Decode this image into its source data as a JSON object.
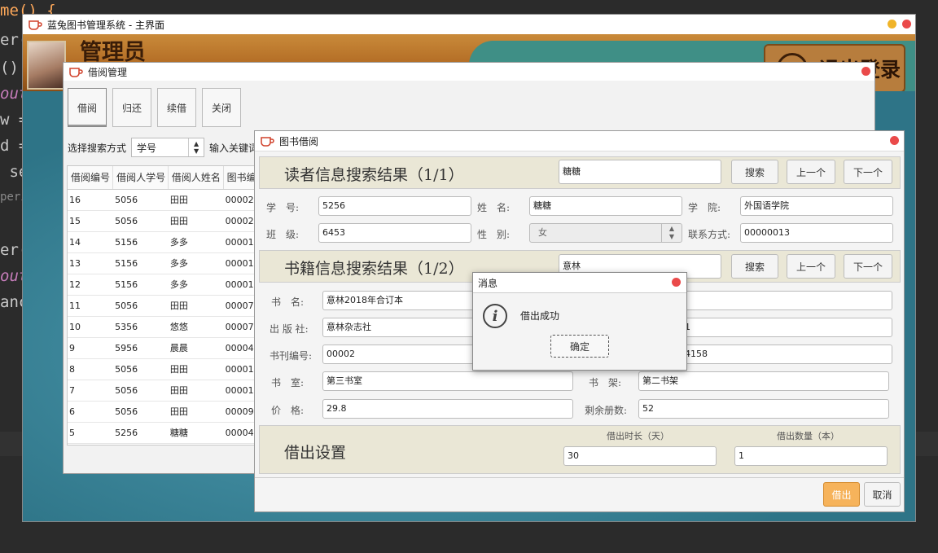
{
  "ide": {
    "lines": [
      "me() {",
      "er(",
      "()",
      "out",
      "w =",
      "d =",
      " se",
      "peri",
      "er(",
      "out",
      "anc"
    ]
  },
  "main_window": {
    "title": "蓝兔图书管理系统 - 主界面",
    "admin_label": "管理员",
    "logout_label": "退出登录"
  },
  "borrow_window": {
    "title": "借阅管理",
    "toolbar": [
      "借阅",
      "归还",
      "续借",
      "关闭"
    ],
    "search_mode_label": "选择搜索方式",
    "search_mode_value": "学号",
    "keyword_label": "输入关键词",
    "columns": [
      "借阅编号",
      "借阅人学号",
      "借阅人姓名",
      "图书编"
    ],
    "rows": [
      [
        "16",
        "5056",
        "田田",
        "00002"
      ],
      [
        "15",
        "5056",
        "田田",
        "00002"
      ],
      [
        "14",
        "5156",
        "多多",
        "00001"
      ],
      [
        "13",
        "5156",
        "多多",
        "00001"
      ],
      [
        "12",
        "5156",
        "多多",
        "00001"
      ],
      [
        "11",
        "5056",
        "田田",
        "00007"
      ],
      [
        "10",
        "5356",
        "悠悠",
        "00007"
      ],
      [
        "9",
        "5956",
        "晨晨",
        "00004"
      ],
      [
        "8",
        "5056",
        "田田",
        "00001"
      ],
      [
        "7",
        "5056",
        "田田",
        "00001"
      ],
      [
        "6",
        "5056",
        "田田",
        "00009"
      ],
      [
        "5",
        "5256",
        "糖糖",
        "00004"
      ]
    ]
  },
  "lend_window": {
    "title": "图书借阅",
    "reader": {
      "section_title": "读者信息搜索结果（1/1）",
      "search_value": "糖糖",
      "search_btn": "搜索",
      "prev_btn": "上一个",
      "next_btn": "下一个",
      "student_id_label": "学　号:",
      "student_id": "5256",
      "name_label": "姓　名:",
      "name": "糖糖",
      "college_label": "学　院:",
      "college": "外国语学院",
      "class_label": "班　级:",
      "class": "6453",
      "gender_label": "性　别:",
      "gender": "女",
      "contact_label": "联系方式:",
      "contact": "00000013"
    },
    "book": {
      "section_title": "书籍信息搜索结果（1/2）",
      "search_value": "意林",
      "search_btn": "搜索",
      "prev_btn": "上一个",
      "next_btn": "下一个",
      "title_label": "书　名:",
      "title": "意林2018年合订本",
      "publisher_label": "出 版 社:",
      "publisher": "意林杂志社",
      "publisher_right_partial": "1",
      "code_label": "书刊编号:",
      "code": "00002",
      "code_right_partial": "4158",
      "room_label": "书　室:",
      "room": "第三书室",
      "shelf_label": "书　架:",
      "shelf": "第二书架",
      "price_label": "价　格:",
      "price": "29.8",
      "remain_label": "剩余册数:",
      "remain": "52"
    },
    "settings": {
      "title": "借出设置",
      "days_label": "借出时长（天）",
      "days": "30",
      "count_label": "借出数量（本）",
      "count": "1"
    },
    "lend_btn": "借出",
    "cancel_btn": "取消"
  },
  "dialog": {
    "title": "消息",
    "message": "借出成功",
    "ok": "确定"
  }
}
